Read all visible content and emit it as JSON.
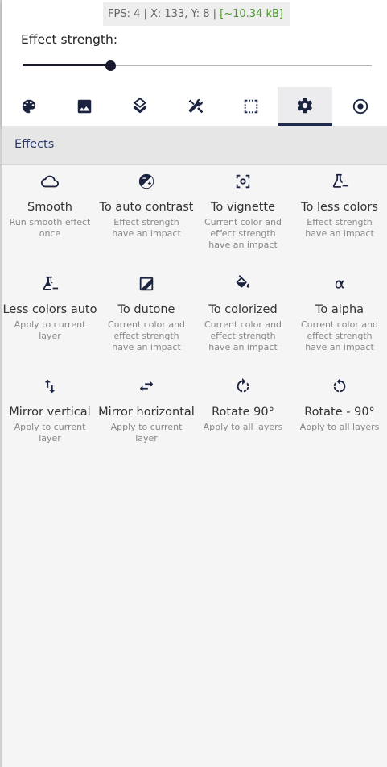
{
  "status": {
    "fps_text": "FPS: 4 | X: 133, Y: 8 | ",
    "size_text": "[~10.34 kB]"
  },
  "strength": {
    "label": "Effect strength:",
    "value_fraction": 0.25
  },
  "tabs": [
    {
      "icon": "palette-icon"
    },
    {
      "icon": "image-icon"
    },
    {
      "icon": "layers-icon"
    },
    {
      "icon": "tools-icon"
    },
    {
      "icon": "selection-icon"
    },
    {
      "icon": "settings-gear-icon",
      "active": true
    },
    {
      "icon": "target-icon"
    }
  ],
  "section": {
    "title": "Effects"
  },
  "effects": [
    {
      "title": "Smooth",
      "desc": "Run smooth effect once",
      "icon": "cloud-icon"
    },
    {
      "title": "To auto contrast",
      "desc": "Effect strength have an impact",
      "icon": "contrast-icon"
    },
    {
      "title": "To vignette",
      "desc": "Current color and effect strength have an impact",
      "icon": "vignette-icon"
    },
    {
      "title": "To less colors",
      "desc": "Effect strength have an impact",
      "icon": "flask-minus-icon"
    },
    {
      "title": "Less colors auto",
      "desc": "Apply to current layer",
      "icon": "flask-auto-icon"
    },
    {
      "title": "To dutone",
      "desc": "Current color and effect strength have an impact",
      "icon": "duotone-image-icon"
    },
    {
      "title": "To colorized",
      "desc": "Current color and effect strength have an impact",
      "icon": "paint-bucket-icon"
    },
    {
      "title": "To alpha",
      "desc": "Current color and effect strength have an impact",
      "icon": "alpha-icon"
    },
    {
      "title": "Mirror vertical",
      "desc": "Apply to current layer",
      "icon": "swap-vertical-icon"
    },
    {
      "title": "Mirror horizontal",
      "desc": "Apply to current layer",
      "icon": "swap-horizontal-icon"
    },
    {
      "title": "Rotate 90°",
      "desc": "Apply to all layers",
      "icon": "rotate-right-icon"
    },
    {
      "title": "Rotate - 90°",
      "desc": "Apply to all layers",
      "icon": "rotate-left-icon"
    }
  ]
}
